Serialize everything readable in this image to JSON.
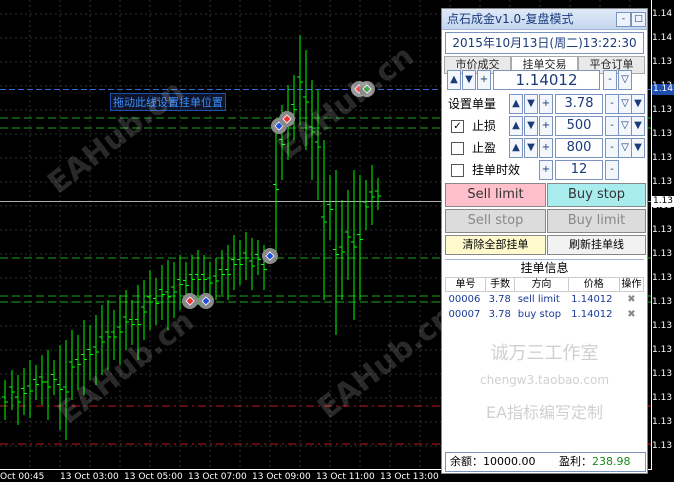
{
  "chart": {
    "drag_hint": "拖动此线设置挂单位置",
    "watermark": "EAHub.cn",
    "price_axis": [
      "1.14",
      "1.14",
      "1.13",
      "1.13",
      "1.13",
      "1.13",
      "1.13",
      "1.13",
      "1.13",
      "1.13",
      "1.13",
      "1.13",
      "1.13",
      "1.13",
      "1.13",
      "1.13",
      "1.13",
      "1.13",
      "1.13"
    ],
    "bid_tag": "1.14",
    "bid_tag_color": "#1e4fb0",
    "last_tag": "1.13",
    "time_axis": [
      "Oct 00:45",
      "13 Oct 03:00",
      "13 Oct 05:00",
      "13 Oct 07:00",
      "13 Oct 09:00",
      "13 Oct 11:00",
      "13 Oct 13:00"
    ],
    "candle_color": "#00ff00",
    "grid_color": "#2f2f2f"
  },
  "panel": {
    "title": "点石成金v1.0-复盘模式",
    "title_buttons": [
      "-",
      "□"
    ],
    "datetime": "2015年10月13日(周二)13:22:30",
    "tabs": [
      "市价成交",
      "挂单交易",
      "平仓订单"
    ],
    "price": {
      "value": "1.14012",
      "minus": "-"
    },
    "lot": {
      "label": "设置单量",
      "value": "3.78"
    },
    "stoploss": {
      "label": "止损",
      "value": "500",
      "checked": true
    },
    "takeprofit": {
      "label": "止盈",
      "value": "800",
      "checked": false
    },
    "expiry": {
      "label": "挂单时效",
      "value": "12",
      "checked": false
    },
    "arrows": {
      "up": "▲",
      "down": "▼",
      "plus": "+",
      "minus": "-",
      "dropdown": "▽"
    },
    "buttons": {
      "sell_limit": "Sell limit",
      "buy_stop": "Buy stop",
      "sell_stop": "Sell stop",
      "buy_limit": "Buy limit",
      "clear_all": "清除全部挂单",
      "refresh": "刷新挂单线"
    },
    "orders_title": "挂单信息",
    "order_headers": [
      "单号",
      "手数",
      "方向",
      "价格",
      "操作"
    ],
    "orders": [
      {
        "id": "00006",
        "lots": "3.78",
        "direction": "sell limit",
        "price": "1.14012",
        "action": "✖"
      },
      {
        "id": "00007",
        "lots": "3.78",
        "direction": "buy stop",
        "price": "1.14012",
        "action": "✖"
      }
    ],
    "watermarks": [
      "诚万三工作室",
      "chengw3.taobao.com",
      "EA指标编写定制"
    ],
    "footer": {
      "balance_label": "余额：",
      "balance": "10000.00",
      "profit_label": "盈利：",
      "profit": "238.98",
      "profit_color": "#1a8a1a"
    }
  }
}
